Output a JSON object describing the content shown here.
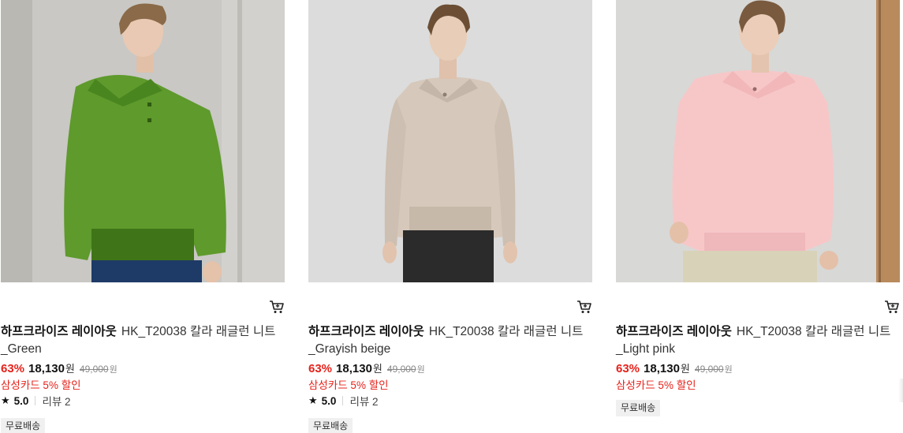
{
  "products": [
    {
      "brand": "하프크라이즈 레이아웃",
      "name": "HK_T20038 칼라 래글런 니트",
      "variant": "_Green",
      "discount": "63%",
      "price": "18,130",
      "currency": "원",
      "original_price": "49,000",
      "original_currency": "원",
      "promo": "삼성카드 5% 할인",
      "rating": "5.0",
      "reviews": "리뷰 2",
      "badge": "무료배송",
      "photo_colors": {
        "bg": "#c9c8c4",
        "knit": "#5e9a2c",
        "knit_dark": "#3f7518",
        "hair": "#8a6a48",
        "skin": "#e9c9b3",
        "pants": "#1e3a66"
      }
    },
    {
      "brand": "하프크라이즈 레이아웃",
      "name": "HK_T20038 칼라 래글런 니트",
      "variant": "_Grayish beige",
      "discount": "63%",
      "price": "18,130",
      "currency": "원",
      "original_price": "49,000",
      "original_currency": "원",
      "promo": "삼성카드 5% 할인",
      "rating": "5.0",
      "reviews": "리뷰 2",
      "badge": "무료배송",
      "photo_colors": {
        "bg": "#dcdcdc",
        "knit": "#d6c9bc",
        "knit_dark": "#b8a999",
        "hair": "#6b4e34",
        "skin": "#e8cdb8",
        "pants": "#2b2b2b"
      }
    },
    {
      "brand": "하프크라이즈 레이아웃",
      "name": "HK_T20038 칼라 래글런 니트",
      "variant": "_Light pink",
      "discount": "63%",
      "price": "18,130",
      "currency": "원",
      "original_price": "49,000",
      "original_currency": "원",
      "promo": "삼성카드 5% 할인",
      "badge": "무료배송",
      "photo_colors": {
        "bg": "#d8d8d6",
        "knit": "#f7c7c8",
        "knit_dark": "#e9a9ab",
        "hair": "#7a5a3e",
        "skin": "#ebcdb9",
        "pants": "#d8d2b8"
      }
    }
  ],
  "icons": {
    "cart": "cart-icon",
    "star": "star-icon"
  }
}
